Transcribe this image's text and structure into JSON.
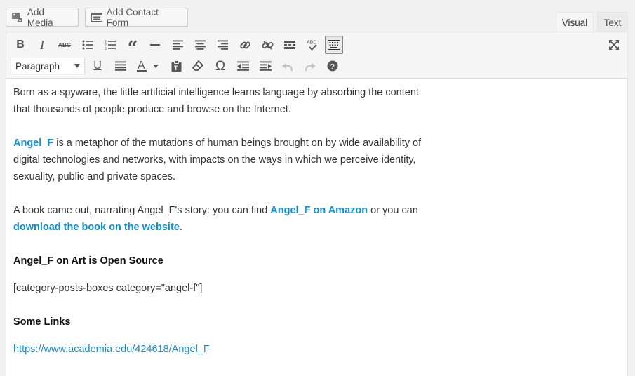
{
  "topbar": {
    "add_media": {
      "label": "Add Media",
      "icon": "media-icon"
    },
    "add_contact_form": {
      "label": "Add Contact Form",
      "icon": "form-icon"
    },
    "tabs": [
      {
        "label": "Visual",
        "active": true
      },
      {
        "label": "Text",
        "active": false
      }
    ]
  },
  "toolbar": {
    "row1": [
      "bold",
      "italic",
      "strikethrough",
      "bullet-list",
      "numbered-list",
      "blockquote",
      "horizontal-line",
      "align-left",
      "align-center",
      "align-right",
      "insert-link",
      "remove-link",
      "read-more",
      "spellcheck",
      "toolbar-toggle"
    ],
    "row2": [
      "underline",
      "justify",
      "text-color",
      "paste-as-text",
      "clear-formatting",
      "special-character",
      "outdent",
      "indent",
      "undo",
      "redo",
      "help"
    ],
    "format_select": {
      "value": "Paragraph"
    }
  },
  "content": {
    "p1": "Born as a spyware, the little artificial intelligence learns language by absorbing the content that thousands of people produce and browse on the Internet.",
    "p2": {
      "link": "Angel_F",
      "text": " is a metaphor of the mutations of human beings brought on by wide availability of digital technologies and networks, with impacts on the ways in which we perceive identity, sexuality, public and private spaces."
    },
    "p3": {
      "text_a": "A book came out, narrating Angel_F's story: you can find ",
      "link_a": "Angel_F on Amazon",
      "text_b": " or you can ",
      "link_b": "download the book on the website",
      "text_c": "."
    },
    "heading1": "Angel_F on Art is Open Source",
    "shortcode": "[category-posts-boxes category=\"angel-f\"]",
    "heading2": "Some Links",
    "link_url": "https://www.academia.edu/424618/Angel_F"
  },
  "colors": {
    "link": "#0e90d2",
    "toolbar_bg": "#f5f5f5"
  }
}
